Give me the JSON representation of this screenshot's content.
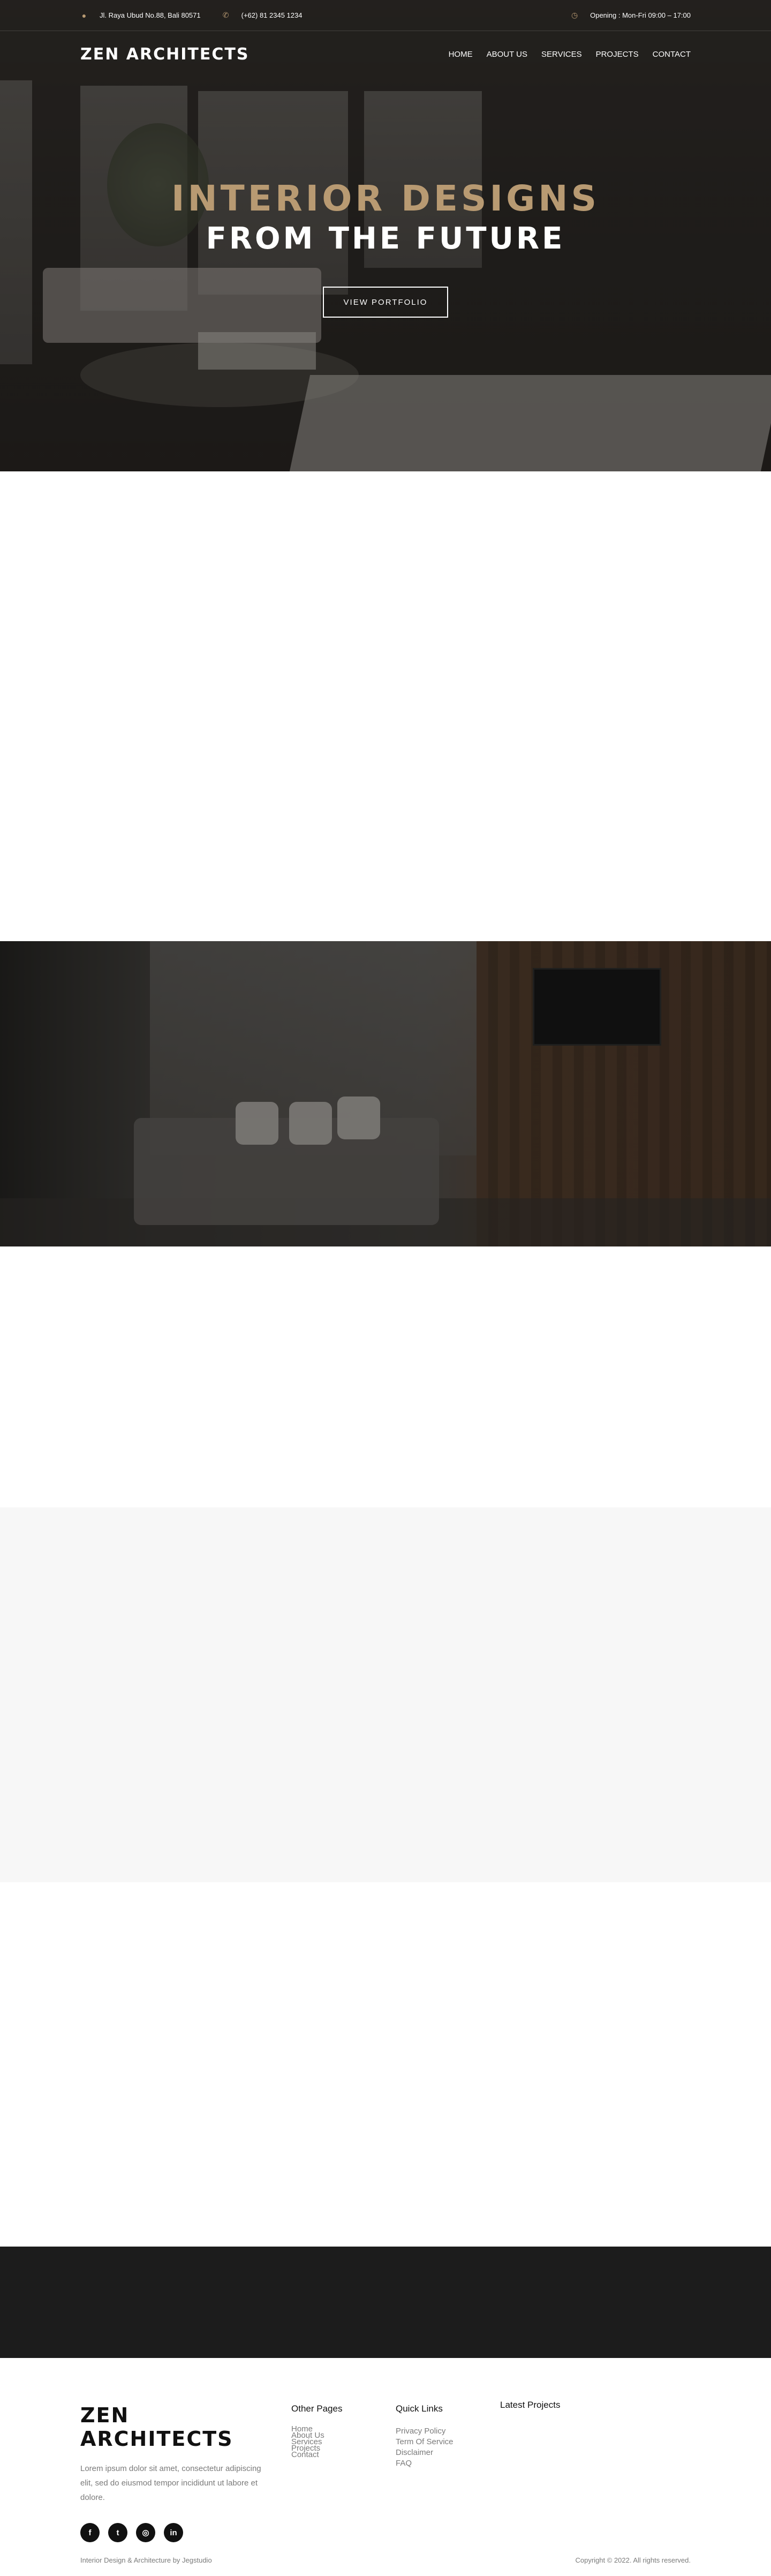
{
  "topbar": {
    "address": "Jl. Raya Ubud No.88, Bali 80571",
    "phone": "(+62) 81 2345 1234",
    "opening": "Opening : Mon-Fri 09:00 – 17:00",
    "address_icon": "map-pin-icon",
    "phone_icon": "phone-icon",
    "clock_icon": "clock-icon"
  },
  "brand": {
    "name": "ZEN ARCHITECTS"
  },
  "nav": {
    "items": [
      "HOME",
      "ABOUT US",
      "SERVICES",
      "PROJECTS",
      "CONTACT"
    ]
  },
  "hero": {
    "title_line1": "INTERIOR DESIGNS",
    "title_line2": "FROM THE FUTURE",
    "button_label": "VIEW PORTFOLIO"
  },
  "colors": {
    "accent": "#b89a72",
    "dark_section": "#1c1c1c",
    "grey_section": "#f7f7f7"
  },
  "footer": {
    "brand": "ZEN ARCHITECTS",
    "description": "Lorem ipsum dolor sit amet, consectetur adipiscing elit, sed do eiusmod tempor incididunt ut labore et dolore.",
    "socials": [
      {
        "icon": "facebook-icon",
        "glyph": "f"
      },
      {
        "icon": "twitter-icon",
        "glyph": "t"
      },
      {
        "icon": "instagram-icon",
        "glyph": "◎"
      },
      {
        "icon": "linkedin-icon",
        "glyph": "in"
      }
    ],
    "other_pages": {
      "title": "Other Pages",
      "links": [
        "Home",
        "About Us",
        "Services",
        "Projects",
        "Contact"
      ]
    },
    "quick_links": {
      "title": "Quick Links",
      "links": [
        "Privacy Policy",
        "Term Of Service",
        "Disclaimer",
        "FAQ"
      ]
    },
    "latest_projects": {
      "title": "Latest Projects"
    },
    "credit": "Interior Design & Architecture by Jegstudio",
    "copyright": "Copyright © 2022. All rights reserved."
  }
}
